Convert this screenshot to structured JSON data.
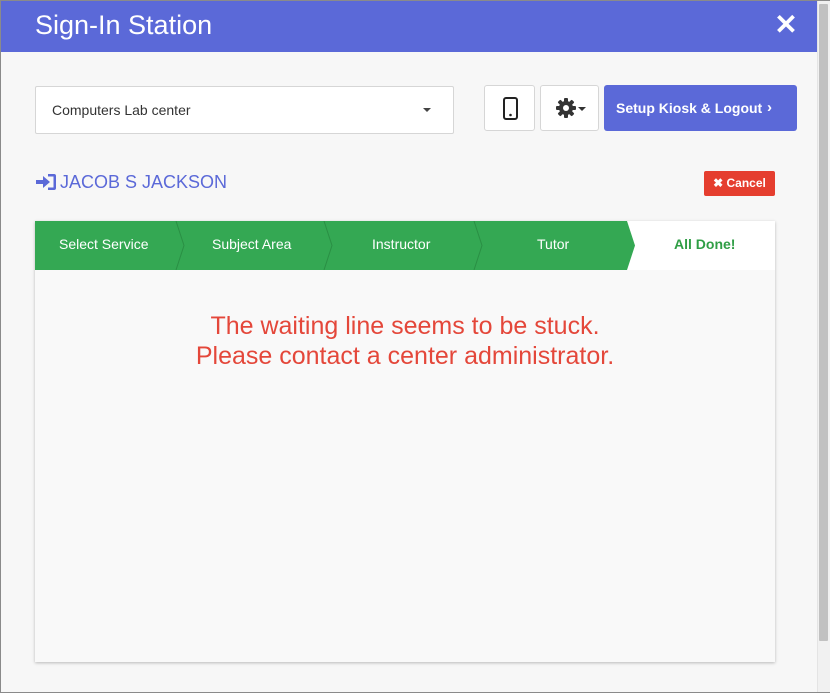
{
  "window": {
    "title": "Sign-In Station"
  },
  "toolbar": {
    "center_select": {
      "value": "Computers Lab center"
    },
    "setup_label": "Setup Kiosk & Logout"
  },
  "user": {
    "name": "JACOB S JACKSON"
  },
  "cancel_label": "Cancel",
  "steps": [
    {
      "label": "Select Service"
    },
    {
      "label": "Subject Area"
    },
    {
      "label": "Instructor"
    },
    {
      "label": "Tutor"
    },
    {
      "label": "All Done!"
    }
  ],
  "message": {
    "line1": "The waiting line seems to be stuck.",
    "line2": "Please contact a center administrator."
  },
  "colors": {
    "brand": "#5b69d8",
    "step_complete": "#34a853",
    "danger": "#e53e2f",
    "error_text": "#e4473a"
  },
  "icons": [
    "close-icon",
    "phone-icon",
    "gear-icon",
    "chevron-right-icon",
    "sign-in-icon",
    "times-icon"
  ]
}
